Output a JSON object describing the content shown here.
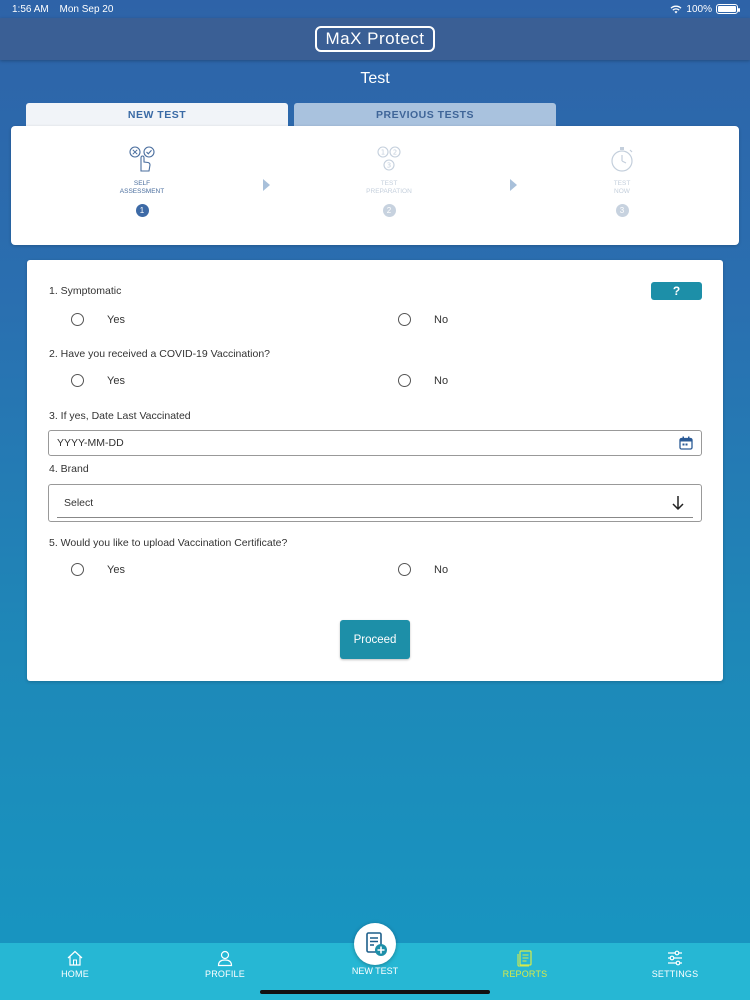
{
  "status_bar": {
    "time": "1:56 AM",
    "date": "Mon Sep 20",
    "battery": "100%"
  },
  "header": {
    "logo": "MaX Protect"
  },
  "page": {
    "title": "Test"
  },
  "tabs": [
    {
      "label": "NEW TEST"
    },
    {
      "label": "PREVIOUS TESTS"
    }
  ],
  "stepper": {
    "steps": [
      {
        "label_line1": "SELF",
        "label_line2": "ASSESSMENT",
        "number": "1",
        "icon": "hand-check-icon"
      },
      {
        "label_line1": "TEST",
        "label_line2": "PREPARATION",
        "number": "2",
        "icon": "steps-icon"
      },
      {
        "label_line1": "TEST",
        "label_line2": "NOW",
        "number": "3",
        "icon": "stopwatch-icon"
      }
    ]
  },
  "form": {
    "q1": {
      "label": "1. Symptomatic",
      "yes": "Yes",
      "no": "No"
    },
    "help_label": "?",
    "q2": {
      "label": "2. Have you received a COVID-19 Vaccination?",
      "yes": "Yes",
      "no": "No"
    },
    "q3": {
      "label": "3. If yes, Date Last Vaccinated",
      "placeholder": "YYYY-MM-DD"
    },
    "q4": {
      "label": "4. Brand",
      "select_value": "Select"
    },
    "q5": {
      "label": "5. Would you like to upload Vaccination Certificate?",
      "yes": "Yes",
      "no": "No"
    },
    "proceed_label": "Proceed"
  },
  "nav": {
    "home": "HOME",
    "profile": "PROFILE",
    "new_test": "NEW TEST",
    "reports": "REPORTS",
    "settings": "SETTINGS"
  },
  "colors": {
    "accent": "#1d8fa8",
    "nav_bg": "#26b7d4",
    "active_nav": "#d7ea4a",
    "step_active": "#3d6aa6"
  }
}
